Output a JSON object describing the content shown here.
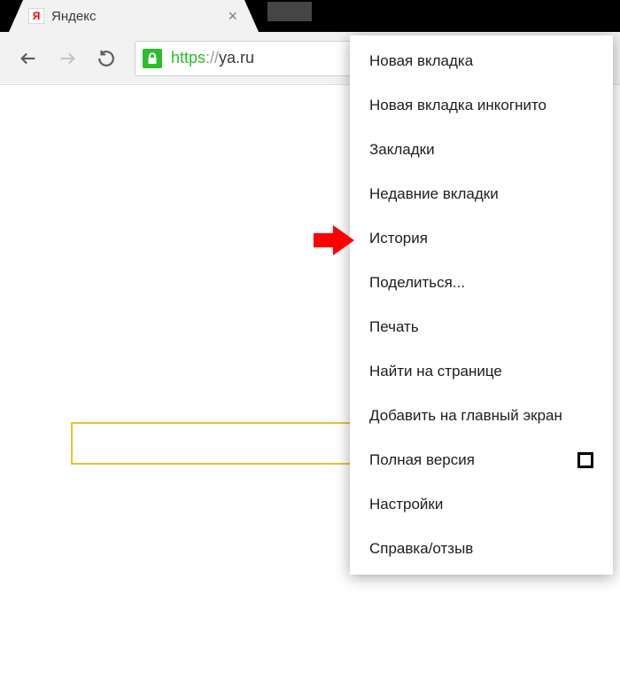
{
  "tab": {
    "title": "Яндекс",
    "favicon_glyph": "Я"
  },
  "omnibox": {
    "scheme": "https",
    "sep": "://",
    "host": "ya.ru"
  },
  "menu": {
    "items": [
      {
        "label": "Новая вкладка"
      },
      {
        "label": "Новая вкладка инкогнито"
      },
      {
        "label": "Закладки"
      },
      {
        "label": "Недавние вкладки"
      },
      {
        "label": "История"
      },
      {
        "label": "Поделиться..."
      },
      {
        "label": "Печать"
      },
      {
        "label": "Найти на странице"
      },
      {
        "label": "Добавить на главный экран"
      },
      {
        "label": "Полная версия",
        "checkbox": true
      },
      {
        "label": "Настройки"
      },
      {
        "label": "Справка/отзыв"
      }
    ]
  },
  "annotation": {
    "arrow_color": "#ff0000",
    "points_at_index": 4
  },
  "colors": {
    "secure_green": "#2abf2a",
    "yandex_yellow": "#e8c22c"
  }
}
